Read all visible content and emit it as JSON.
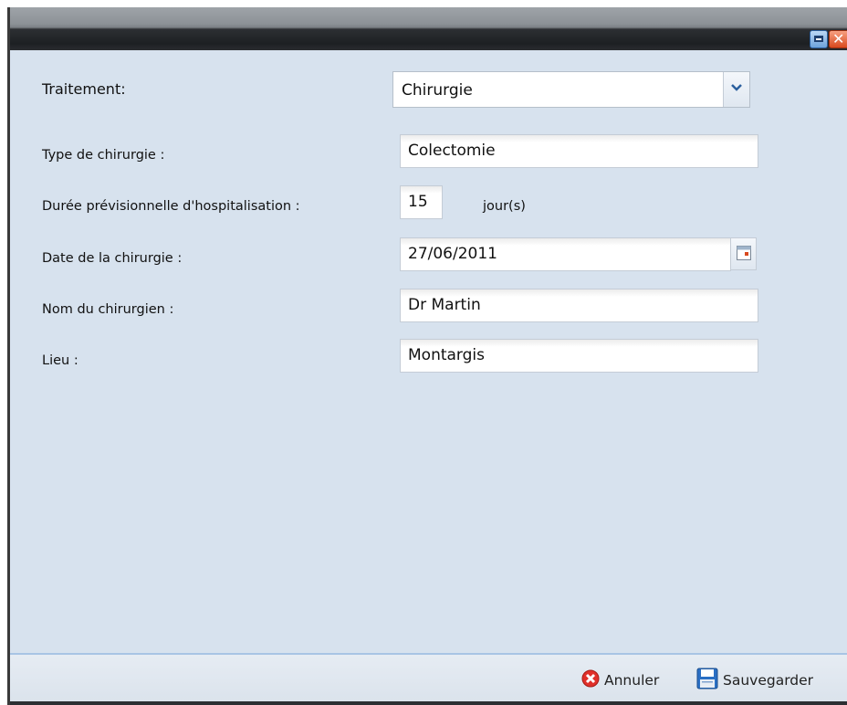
{
  "window": {
    "title": "",
    "restore_icon": "restore-icon",
    "close_icon": "close-icon"
  },
  "form": {
    "traitement": {
      "label": "Traitement:",
      "value": "Chirurgie"
    },
    "type_chirurgie": {
      "label": "Type de chirurgie :",
      "value": "Colectomie"
    },
    "duree": {
      "label": "Durée prévisionnelle d'hospitalisation :",
      "value": "15",
      "unit": "jour(s)"
    },
    "date": {
      "label": "Date de la chirurgie :",
      "value": "27/06/2011"
    },
    "chirurgien": {
      "label": "Nom du chirurgien :",
      "value": "Dr Martin"
    },
    "lieu": {
      "label": "Lieu :",
      "value": "Montargis"
    }
  },
  "footer": {
    "cancel_label": "Annuler",
    "save_label": "Sauvegarder"
  },
  "colors": {
    "panel": "#d7e2ee",
    "titlebar": "#1d2023",
    "accent": "#2b5f9e",
    "cancel": "#e0302a",
    "save": "#2a6fc4"
  }
}
